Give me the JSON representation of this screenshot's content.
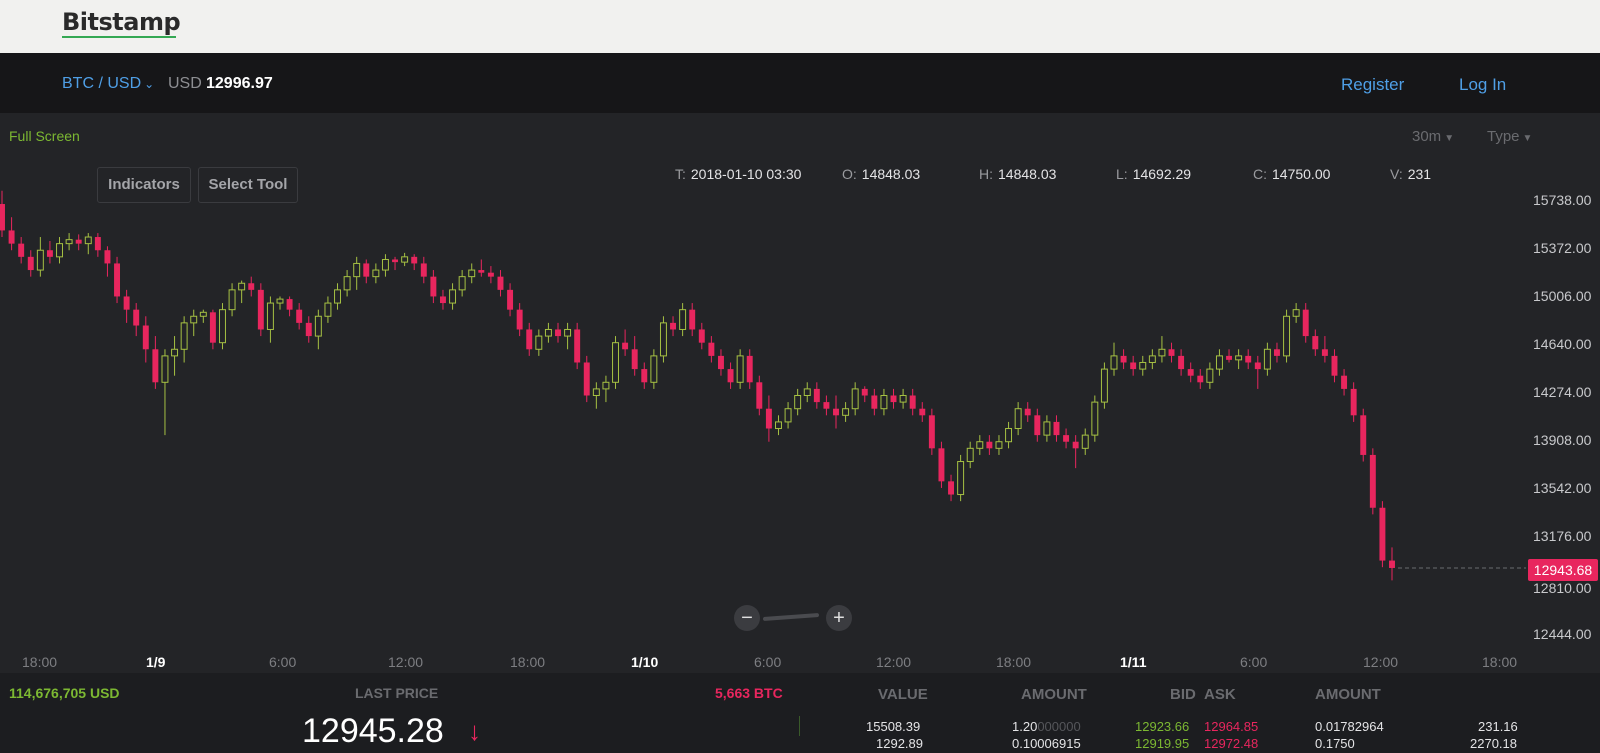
{
  "header": {
    "logo": "Bitstamp"
  },
  "nav": {
    "pair": "BTC / USD",
    "price_label": "USD",
    "price_value": "12996.97",
    "register": "Register",
    "login": "Log In"
  },
  "chart_toolbar": {
    "full_screen": "Full Screen",
    "indicators": "Indicators",
    "select_tool": "Select Tool",
    "interval": "30m",
    "type": "Type"
  },
  "ohlc": {
    "t_label": "T:",
    "t_value": "2018-01-10 03:30",
    "o_label": "O:",
    "o_value": "14848.03",
    "h_label": "H:",
    "h_value": "14848.03",
    "l_label": "L:",
    "l_value": "14692.29",
    "c_label": "C:",
    "c_value": "14750.00",
    "v_label": "V:",
    "v_value": "231"
  },
  "chart_data": {
    "type": "candlestick",
    "y_ticks": [
      "15738.00",
      "15372.00",
      "15006.00",
      "14640.00",
      "14274.00",
      "13908.00",
      "13542.00",
      "13176.00",
      "12810.00",
      "12444.00"
    ],
    "x_ticks": [
      "18:00",
      "1/9",
      "6:00",
      "12:00",
      "18:00",
      "1/10",
      "6:00",
      "12:00",
      "18:00",
      "1/11",
      "6:00",
      "12:00",
      "18:00"
    ],
    "last_price_marker": "12943.68",
    "up_color": "#a6c143",
    "down_color": "#e8265e",
    "candles": [
      [
        15700,
        15800,
        15450,
        15500
      ],
      [
        15500,
        15600,
        15350,
        15400
      ],
      [
        15400,
        15450,
        15250,
        15300
      ],
      [
        15300,
        15350,
        15150,
        15200
      ],
      [
        15200,
        15450,
        15150,
        15350
      ],
      [
        15350,
        15420,
        15250,
        15300
      ],
      [
        15300,
        15450,
        15250,
        15400
      ],
      [
        15400,
        15480,
        15350,
        15430
      ],
      [
        15430,
        15470,
        15350,
        15400
      ],
      [
        15400,
        15480,
        15320,
        15450
      ],
      [
        15450,
        15480,
        15300,
        15350
      ],
      [
        15350,
        15380,
        15150,
        15250
      ],
      [
        15250,
        15300,
        14950,
        15000
      ],
      [
        15000,
        15050,
        14800,
        14900
      ],
      [
        14900,
        14950,
        14700,
        14780
      ],
      [
        14780,
        14850,
        14500,
        14600
      ],
      [
        14600,
        14700,
        14300,
        14350
      ],
      [
        14350,
        14600,
        13950,
        14550
      ],
      [
        14550,
        14700,
        14400,
        14600
      ],
      [
        14600,
        14850,
        14500,
        14800
      ],
      [
        14800,
        14900,
        14700,
        14850
      ],
      [
        14850,
        14900,
        14800,
        14880
      ],
      [
        14880,
        14900,
        14600,
        14650
      ],
      [
        14650,
        14950,
        14600,
        14900
      ],
      [
        14900,
        15100,
        14850,
        15050
      ],
      [
        15050,
        15120,
        14950,
        15100
      ],
      [
        15100,
        15150,
        15000,
        15050
      ],
      [
        15050,
        15100,
        14700,
        14750
      ],
      [
        14750,
        15000,
        14650,
        14950
      ],
      [
        14950,
        15000,
        14900,
        14980
      ],
      [
        14980,
        15000,
        14850,
        14900
      ],
      [
        14900,
        14950,
        14750,
        14800
      ],
      [
        14800,
        14850,
        14650,
        14700
      ],
      [
        14700,
        14900,
        14600,
        14850
      ],
      [
        14850,
        15000,
        14800,
        14950
      ],
      [
        14950,
        15100,
        14900,
        15050
      ],
      [
        15050,
        15200,
        15000,
        15150
      ],
      [
        15150,
        15300,
        15050,
        15250
      ],
      [
        15250,
        15280,
        15100,
        15150
      ],
      [
        15150,
        15250,
        15100,
        15200
      ],
      [
        15200,
        15320,
        15150,
        15280
      ],
      [
        15280,
        15300,
        15200,
        15260
      ],
      [
        15260,
        15330,
        15230,
        15300
      ],
      [
        15300,
        15320,
        15200,
        15250
      ],
      [
        15250,
        15300,
        15100,
        15150
      ],
      [
        15150,
        15200,
        14950,
        15000
      ],
      [
        15000,
        15050,
        14900,
        14950
      ],
      [
        14950,
        15100,
        14900,
        15050
      ],
      [
        15050,
        15200,
        15000,
        15150
      ],
      [
        15150,
        15250,
        15100,
        15200
      ],
      [
        15200,
        15280,
        15150,
        15180
      ],
      [
        15180,
        15230,
        15100,
        15150
      ],
      [
        15150,
        15200,
        15000,
        15050
      ],
      [
        15050,
        15100,
        14850,
        14900
      ],
      [
        14900,
        14950,
        14700,
        14750
      ],
      [
        14750,
        14800,
        14550,
        14600
      ],
      [
        14600,
        14750,
        14550,
        14700
      ],
      [
        14700,
        14800,
        14650,
        14750
      ],
      [
        14750,
        14800,
        14650,
        14700
      ],
      [
        14700,
        14800,
        14600,
        14750
      ],
      [
        14750,
        14800,
        14450,
        14500
      ],
      [
        14500,
        14550,
        14200,
        14250
      ],
      [
        14250,
        14350,
        14150,
        14300
      ],
      [
        14300,
        14400,
        14200,
        14350
      ],
      [
        14350,
        14700,
        14300,
        14650
      ],
      [
        14650,
        14750,
        14550,
        14600
      ],
      [
        14600,
        14700,
        14400,
        14450
      ],
      [
        14450,
        14500,
        14300,
        14350
      ],
      [
        14350,
        14600,
        14300,
        14550
      ],
      [
        14550,
        14850,
        14500,
        14800
      ],
      [
        14800,
        14850,
        14700,
        14750
      ],
      [
        14750,
        14950,
        14700,
        14900
      ],
      [
        14900,
        14950,
        14700,
        14750
      ],
      [
        14750,
        14800,
        14600,
        14650
      ],
      [
        14650,
        14700,
        14500,
        14550
      ],
      [
        14550,
        14600,
        14400,
        14450
      ],
      [
        14450,
        14500,
        14300,
        14350
      ],
      [
        14350,
        14600,
        14300,
        14550
      ],
      [
        14550,
        14600,
        14300,
        14350
      ],
      [
        14350,
        14400,
        14100,
        14150
      ],
      [
        14150,
        14250,
        13900,
        14000
      ],
      [
        14000,
        14100,
        13950,
        14050
      ],
      [
        14050,
        14200,
        14000,
        14150
      ],
      [
        14150,
        14300,
        14100,
        14250
      ],
      [
        14250,
        14350,
        14200,
        14300
      ],
      [
        14300,
        14350,
        14150,
        14200
      ],
      [
        14200,
        14250,
        14100,
        14150
      ],
      [
        14150,
        14250,
        14000,
        14100
      ],
      [
        14100,
        14200,
        14050,
        14150
      ],
      [
        14150,
        14350,
        14100,
        14300
      ],
      [
        14300,
        14320,
        14200,
        14250
      ],
      [
        14250,
        14300,
        14100,
        14150
      ],
      [
        14150,
        14300,
        14100,
        14250
      ],
      [
        14250,
        14300,
        14150,
        14200
      ],
      [
        14200,
        14300,
        14150,
        14250
      ],
      [
        14250,
        14300,
        14100,
        14150
      ],
      [
        14150,
        14200,
        14050,
        14100
      ],
      [
        14100,
        14150,
        13800,
        13850
      ],
      [
        13850,
        13900,
        13550,
        13600
      ],
      [
        13600,
        13650,
        13450,
        13500
      ],
      [
        13500,
        13800,
        13450,
        13750
      ],
      [
        13750,
        13900,
        13700,
        13850
      ],
      [
        13850,
        13950,
        13800,
        13900
      ],
      [
        13900,
        13950,
        13800,
        13850
      ],
      [
        13850,
        13950,
        13800,
        13900
      ],
      [
        13900,
        14050,
        13850,
        14000
      ],
      [
        14000,
        14200,
        13950,
        14150
      ],
      [
        14150,
        14200,
        14050,
        14100
      ],
      [
        14100,
        14150,
        13900,
        13950
      ],
      [
        13950,
        14100,
        13900,
        14050
      ],
      [
        14050,
        14100,
        13900,
        13950
      ],
      [
        13950,
        14000,
        13850,
        13900
      ],
      [
        13900,
        13950,
        13700,
        13850
      ],
      [
        13850,
        14000,
        13800,
        13950
      ],
      [
        13950,
        14250,
        13900,
        14200
      ],
      [
        14200,
        14500,
        14150,
        14450
      ],
      [
        14450,
        14650,
        14400,
        14550
      ],
      [
        14550,
        14600,
        14450,
        14500
      ],
      [
        14500,
        14550,
        14400,
        14450
      ],
      [
        14450,
        14550,
        14400,
        14500
      ],
      [
        14500,
        14600,
        14450,
        14550
      ],
      [
        14550,
        14700,
        14500,
        14600
      ],
      [
        14600,
        14650,
        14500,
        14550
      ],
      [
        14550,
        14600,
        14400,
        14450
      ],
      [
        14450,
        14500,
        14350,
        14400
      ],
      [
        14400,
        14450,
        14300,
        14350
      ],
      [
        14350,
        14500,
        14300,
        14450
      ],
      [
        14450,
        14600,
        14400,
        14550
      ],
      [
        14550,
        14600,
        14500,
        14520
      ],
      [
        14520,
        14600,
        14450,
        14550
      ],
      [
        14550,
        14600,
        14450,
        14500
      ],
      [
        14500,
        14550,
        14300,
        14450
      ],
      [
        14450,
        14650,
        14400,
        14600
      ],
      [
        14600,
        14650,
        14500,
        14550
      ],
      [
        14550,
        14900,
        14500,
        14850
      ],
      [
        14850,
        14950,
        14800,
        14900
      ],
      [
        14900,
        14950,
        14650,
        14700
      ],
      [
        14700,
        14750,
        14550,
        14600
      ],
      [
        14600,
        14700,
        14500,
        14550
      ],
      [
        14550,
        14600,
        14350,
        14400
      ],
      [
        14400,
        14450,
        14250,
        14300
      ],
      [
        14300,
        14350,
        14050,
        14100
      ],
      [
        14100,
        14150,
        13750,
        13800
      ],
      [
        13800,
        13850,
        13350,
        13400
      ],
      [
        13400,
        13450,
        12950,
        13000
      ],
      [
        13000,
        13100,
        12850,
        12944
      ]
    ]
  },
  "bottom": {
    "volume_usd": "114,676,705 USD",
    "last_price_label": "LAST PRICE",
    "volume_btc": "5,663 BTC",
    "last_price": "12945.28",
    "columns": {
      "value": "VALUE",
      "amount1": "AMOUNT",
      "bid": "BID",
      "ask": "ASK",
      "amount2": "AMOUNT"
    },
    "rows": [
      {
        "value": "15508.39",
        "amount_main": "1.20",
        "amount_dim": "000000",
        "bid": "12923.66",
        "ask": "12964.85",
        "amount2": "0.01782964",
        "total": "231.16"
      },
      {
        "value": "1292.89",
        "amount_main": "0.10006915",
        "amount_dim": "",
        "bid": "12919.95",
        "ask": "12972.48",
        "amount2": "0.1750",
        "total": "2270.18"
      }
    ]
  }
}
